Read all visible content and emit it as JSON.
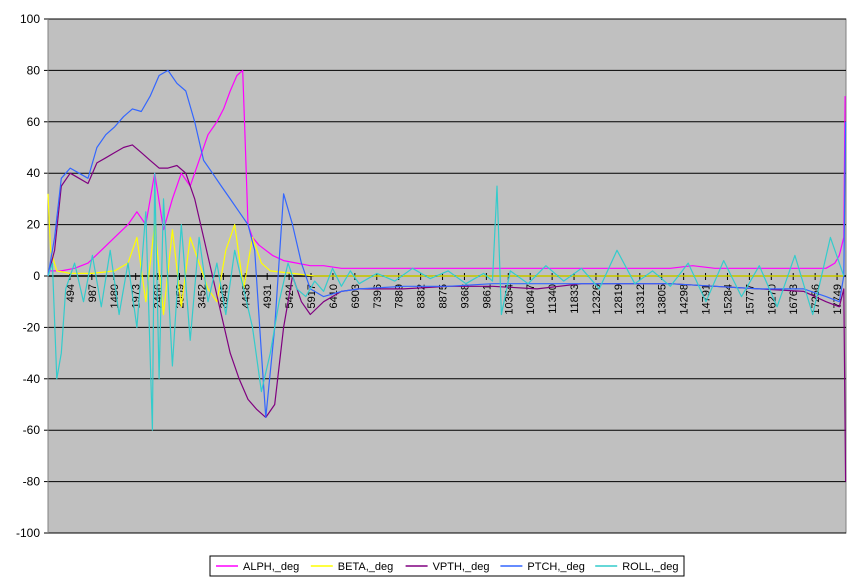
{
  "chart_data": {
    "type": "line",
    "ylim": [
      -100,
      100
    ],
    "xlim": [
      1,
      17950
    ],
    "y_ticks": [
      "100",
      "80",
      "60",
      "40",
      "20",
      "0",
      "-20",
      "-40",
      "-60",
      "-80",
      "-100"
    ],
    "y_tick_values": [
      100,
      80,
      60,
      40,
      20,
      0,
      -20,
      -40,
      -60,
      -80,
      -100
    ],
    "x_tick_labels": [
      "494",
      "987",
      "1480",
      "1973",
      "2466",
      "2959",
      "3452",
      "3945",
      "4438",
      "4931",
      "5424",
      "5917",
      "6410",
      "6903",
      "7396",
      "7889",
      "8382",
      "8875",
      "9368",
      "9861",
      "10354",
      "10847",
      "11340",
      "11833",
      "12326",
      "12819",
      "13312",
      "13805",
      "14298",
      "14791",
      "15284",
      "15777",
      "16270",
      "16763",
      "17256",
      "17749"
    ],
    "x_tick_values": [
      494,
      987,
      1480,
      1973,
      2466,
      2959,
      3452,
      3945,
      4438,
      4931,
      5424,
      5917,
      6410,
      6903,
      7396,
      7889,
      8382,
      8875,
      9368,
      9861,
      10354,
      10847,
      11340,
      11833,
      12326,
      12819,
      13312,
      13805,
      14298,
      14791,
      15284,
      15777,
      16270,
      16763,
      17256,
      17749
    ],
    "grid": true,
    "plot_background": "#c0c0c0",
    "legend_position": "bottom",
    "series": [
      {
        "name": "ALPH,_deg",
        "color": "#ff00ff",
        "x": [
          1,
          300,
          600,
          900,
          1200,
          1500,
          1800,
          2000,
          2200,
          2400,
          2600,
          2800,
          3000,
          3200,
          3400,
          3600,
          3800,
          3950,
          4100,
          4250,
          4380,
          4440,
          4500,
          4600,
          4750,
          4900,
          5050,
          5300,
          5600,
          5900,
          6200,
          6600,
          7000,
          7500,
          8000,
          9000,
          10000,
          11000,
          12000,
          13000,
          14000,
          14500,
          15000,
          16000,
          17000,
          17500,
          17700,
          17800,
          17900,
          17930
        ],
        "values": [
          2,
          2,
          3,
          5,
          10,
          15,
          20,
          25,
          20,
          40,
          18,
          30,
          40,
          35,
          45,
          55,
          60,
          65,
          72,
          78,
          80,
          50,
          20,
          15,
          12,
          10,
          8,
          6,
          5,
          4,
          4,
          3,
          3,
          3,
          3,
          3,
          3,
          3,
          3,
          3,
          3,
          4,
          3,
          3,
          3,
          3,
          5,
          8,
          15,
          70
        ]
      },
      {
        "name": "BETA,_deg",
        "color": "#ffff00",
        "x": [
          1,
          60,
          200,
          500,
          1000,
          1500,
          1800,
          2000,
          2200,
          2400,
          2600,
          2800,
          3000,
          3200,
          3400,
          3600,
          3800,
          4000,
          4200,
          4400,
          4600,
          4800,
          5000,
          5500,
          6000,
          7000,
          8000,
          9000,
          10000,
          11000,
          12000,
          13000,
          14000,
          15000,
          16000,
          17000,
          17900
        ],
        "values": [
          32,
          10,
          2,
          1,
          1,
          2,
          5,
          15,
          -10,
          20,
          -15,
          18,
          -12,
          15,
          5,
          -5,
          -10,
          10,
          20,
          -5,
          15,
          5,
          2,
          1,
          0,
          0,
          0,
          0,
          0,
          0,
          0,
          0,
          0,
          0,
          0,
          0,
          0
        ]
      },
      {
        "name": "VPTH,_deg",
        "color": "#800080",
        "x": [
          1,
          150,
          300,
          500,
          700,
          900,
          1100,
          1300,
          1500,
          1700,
          1900,
          2100,
          2300,
          2500,
          2700,
          2900,
          3100,
          3300,
          3500,
          3700,
          3900,
          4100,
          4300,
          4500,
          4700,
          4900,
          5100,
          5300,
          5500,
          5700,
          5900,
          6200,
          6600,
          7000,
          8000,
          9000,
          10000,
          11000,
          12000,
          13000,
          14000,
          15000,
          16000,
          17000,
          17500,
          17800,
          17900,
          17940
        ],
        "values": [
          0,
          10,
          35,
          40,
          38,
          36,
          44,
          46,
          48,
          50,
          51,
          48,
          45,
          42,
          42,
          43,
          40,
          30,
          15,
          0,
          -15,
          -30,
          -40,
          -48,
          -52,
          -55,
          -50,
          -20,
          0,
          -10,
          -15,
          -10,
          -6,
          -5,
          -5,
          -4,
          -4,
          -5,
          -3,
          -3,
          -3,
          -4,
          -5,
          -6,
          -10,
          -12,
          -5,
          -80
        ]
      },
      {
        "name": "PTCH,_deg",
        "color": "#3366ff",
        "x": [
          1,
          150,
          300,
          500,
          700,
          900,
          1100,
          1300,
          1500,
          1700,
          1900,
          2100,
          2300,
          2500,
          2700,
          2900,
          3100,
          3300,
          3500,
          3700,
          3900,
          4100,
          4300,
          4500,
          4650,
          4800,
          4900,
          5100,
          5300,
          5500,
          5700,
          5900,
          6200,
          6600,
          7000,
          8000,
          9000,
          10000,
          11000,
          12000,
          13000,
          14000,
          15000,
          16000,
          17000,
          17500,
          17800,
          17900,
          17940
        ],
        "values": [
          0,
          15,
          38,
          42,
          40,
          38,
          50,
          55,
          58,
          62,
          65,
          64,
          70,
          78,
          80,
          75,
          72,
          60,
          45,
          40,
          35,
          30,
          25,
          20,
          10,
          -30,
          -55,
          -20,
          32,
          20,
          5,
          -5,
          -8,
          -6,
          -5,
          -4,
          -4,
          -3,
          -3,
          -3,
          -3,
          -3,
          -4,
          -5,
          -5,
          -8,
          -10,
          0,
          60
        ]
      },
      {
        "name": "ROLL,_deg",
        "color": "#33cccc",
        "x": [
          1,
          100,
          200,
          300,
          400,
          600,
          800,
          1000,
          1200,
          1400,
          1600,
          1800,
          2000,
          2200,
          2350,
          2400,
          2500,
          2600,
          2800,
          3000,
          3200,
          3400,
          3600,
          3800,
          4000,
          4200,
          4400,
          4600,
          4800,
          5000,
          5200,
          5400,
          5600,
          5800,
          6000,
          6200,
          6400,
          6600,
          6800,
          7000,
          7400,
          7800,
          8200,
          8600,
          9000,
          9400,
          9800,
          10000,
          10100,
          10200,
          10400,
          10800,
          11200,
          11600,
          12000,
          12400,
          12800,
          13200,
          13600,
          14000,
          14400,
          14800,
          15200,
          15600,
          16000,
          16400,
          16800,
          17200,
          17600,
          17900
        ],
        "values": [
          0,
          5,
          -40,
          -30,
          -5,
          5,
          -10,
          8,
          -12,
          10,
          -15,
          5,
          -20,
          25,
          -60,
          40,
          -40,
          30,
          -35,
          20,
          -25,
          15,
          -10,
          5,
          -15,
          10,
          -5,
          -20,
          -45,
          -30,
          -10,
          5,
          -5,
          -8,
          -2,
          -6,
          3,
          -4,
          2,
          -3,
          1,
          -2,
          3,
          -1,
          2,
          -3,
          1,
          -2,
          35,
          -15,
          2,
          -3,
          4,
          -2,
          3,
          -5,
          10,
          -3,
          2,
          -4,
          5,
          -10,
          6,
          -8,
          4,
          -12,
          8,
          -15,
          15,
          0
        ]
      }
    ]
  }
}
